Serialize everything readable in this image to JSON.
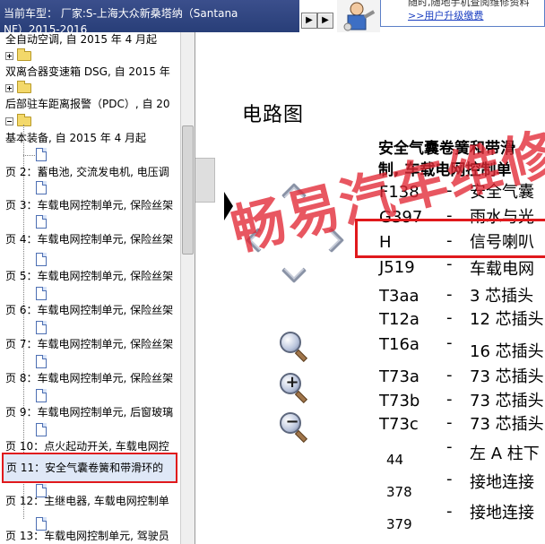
{
  "topbar": {
    "model_title_line1": "当前车型： 厂家:S-上海大众新桑塔纳（Santana",
    "model_title_line2": "NF）2015-2016",
    "prev_glyph": "▶",
    "next_glyph": "▶",
    "ad_text": "随时,随地手机查阅维修资料",
    "upgrade_link": ">>用户升级缴费"
  },
  "sidebar": {
    "tree": [
      {
        "type": "text",
        "label": "全自动空调, 自 2015 年 4 月起"
      },
      {
        "type": "folder",
        "expander": "plus"
      },
      {
        "type": "text",
        "label": "双离合器变速箱 DSG, 自 2015 年"
      },
      {
        "type": "folder",
        "expander": "plus"
      },
      {
        "type": "text",
        "label": "后部驻车距离报警（PDC）, 自 20"
      },
      {
        "type": "folder",
        "expander": "minus"
      },
      {
        "type": "text",
        "label": "基本装备, 自 2015 年 4 月起"
      }
    ],
    "pages": [
      "页 2：蓄电池, 交流发电机, 电压调",
      "页 3：车载电网控制单元, 保险丝架",
      "页 4：车载电网控制单元, 保险丝架",
      "页 5：车载电网控制单元, 保险丝架",
      "页 6：车载电网控制单元, 保险丝架",
      "页 7：车载电网控制单元, 保险丝架",
      "页 8：车载电网控制单元, 保险丝架",
      "页 9：车载电网控制单元, 后窗玻璃",
      "页 10：点火起动开关, 车载电网控",
      "页 11：安全气囊卷簧和带滑环的",
      "页 12：主继电器, 车载电网控制单",
      "页 13：车载电网控制单元, 驾驶员"
    ],
    "selected_page_index": 9
  },
  "main": {
    "section_title": "电路图",
    "legend_heading_line1": "安全气囊卷簧和带滑",
    "legend_heading_line2": "制, 车载电网控制单",
    "legend": [
      {
        "code": "F138",
        "dash": "-",
        "desc": "安全气囊"
      },
      {
        "code": "G397",
        "dash": "-",
        "desc": "雨水与光"
      },
      {
        "code": "H",
        "dash": "-",
        "desc": "信号喇叭"
      },
      {
        "code": "J519",
        "dash": "-",
        "desc": "车载电网"
      },
      {
        "code": "T3aa",
        "dash": "-",
        "desc": "3 芯插头"
      },
      {
        "code": "T12a",
        "dash": "-",
        "desc": "12 芯插头"
      },
      {
        "code": "T16a",
        "dash": "-",
        "desc": "16 芯插头"
      },
      {
        "code": "T73a",
        "dash": "-",
        "desc": "73 芯插头"
      },
      {
        "code": "T73b",
        "dash": "-",
        "desc": "73 芯插头"
      },
      {
        "code": "T73c",
        "dash": "-",
        "desc": "73 芯插头"
      },
      {
        "code": "44",
        "dash": "-",
        "desc": "左 A 柱下"
      },
      {
        "code": "378",
        "dash": "-",
        "desc": "接地连接"
      },
      {
        "code": "379",
        "dash": "-",
        "desc": "接地连接"
      }
    ],
    "highlighted_code": "H",
    "watermark": "畅易汽车维修"
  },
  "colors": {
    "title_bar": "#283e78",
    "highlight_red": "#e0191c",
    "watermark_red": "#e22834",
    "link_blue": "#1b3fc1",
    "selection_bg": "#dfe8f7"
  },
  "icons": {
    "zoom": "magnifier-icon",
    "zoom_in": "zoom-in-icon",
    "zoom_out": "zoom-out-icon",
    "pan": [
      "chevron-up-icon",
      "chevron-left-icon",
      "chevron-right-icon",
      "chevron-down-icon"
    ]
  }
}
